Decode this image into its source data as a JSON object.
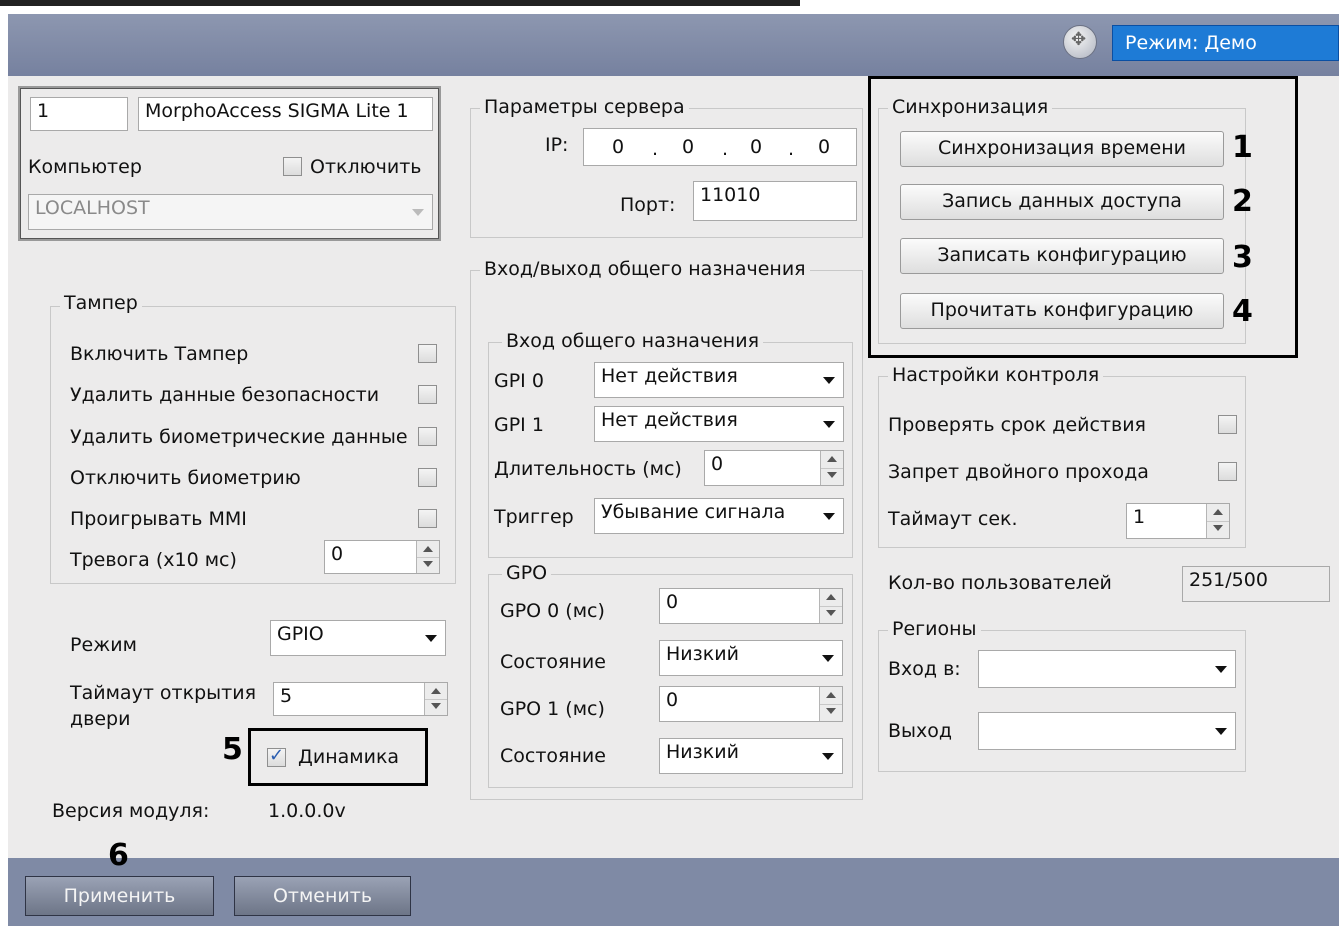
{
  "header": {
    "mode_label": "Режим: Демо"
  },
  "device": {
    "number": "1",
    "name": "MorphoAccess SIGMA Lite 1",
    "computer_label": "Компьютер",
    "disable_label": "Отключить",
    "host": "LOCALHOST"
  },
  "tamper": {
    "legend": "Тампер",
    "items": [
      "Включить Тампер",
      "Удалить данные безопасности",
      "Удалить биометрические данные",
      "Отключить биометрию",
      "Проигрывать MMI"
    ],
    "alarm_label": "Тревога (x10 мс)",
    "alarm_value": "0"
  },
  "mode": {
    "mode_label": "Режим",
    "mode_value": "GPIO",
    "door_timeout_label_1": "Таймаут открытия",
    "door_timeout_label_2": "двери",
    "door_timeout_value": "5",
    "speaker_label": "Динамика",
    "version_label": "Версия модуля:",
    "version_value": "1.0.0.0v"
  },
  "server": {
    "legend": "Параметры сервера",
    "ip_label": "IP:",
    "ip": [
      "0",
      "0",
      "0",
      "0"
    ],
    "port_label": "Порт:",
    "port": "11010"
  },
  "gpio": {
    "legend": "Вход/выход общего назначения",
    "gpi_legend": "Вход общего назначения",
    "gpi0_label": "GPI 0",
    "gpi0_value": "Нет действия",
    "gpi1_label": "GPI 1",
    "gpi1_value": "Нет действия",
    "duration_label": "Длительность (мс)",
    "duration_value": "0",
    "trigger_label": "Триггер",
    "trigger_value": "Убывание сигнала",
    "gpo_legend": "GPO",
    "gpo0_label": "GPO 0 (мс)",
    "gpo0_value": "0",
    "state_label": "Состояние",
    "state0_value": "Низкий",
    "gpo1_label": "GPO 1 (мс)",
    "gpo1_value": "0",
    "state1_value": "Низкий"
  },
  "sync": {
    "legend": "Синхронизация",
    "buttons": [
      "Синхронизация времени",
      "Запись данных доступа",
      "Записать конфигурацию",
      "Прочитать конфигурацию"
    ]
  },
  "control": {
    "legend": "Настройки контроля",
    "check_validity": "Проверять срок действия",
    "antipassback": "Запрет двойного прохода",
    "timeout_label": "Таймаут сек.",
    "timeout_value": "1",
    "users_label": "Кол-во пользователей",
    "users_value": "251/500"
  },
  "regions": {
    "legend": "Регионы",
    "entry_label": "Вход в:",
    "exit_label": "Выход"
  },
  "footer": {
    "apply": "Применить",
    "cancel": "Отменить"
  },
  "callouts": [
    "1",
    "2",
    "3",
    "4",
    "5",
    "6"
  ]
}
